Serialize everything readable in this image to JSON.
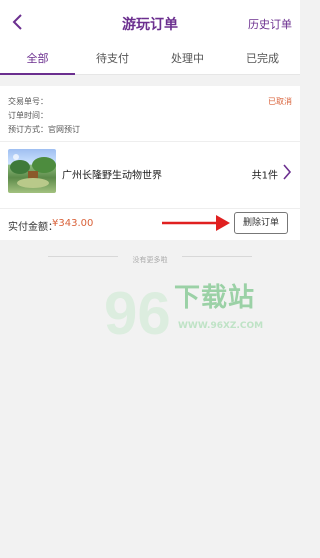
{
  "header": {
    "title": "游玩订单",
    "history_label": "历史订单"
  },
  "tabs": [
    {
      "label": "全部",
      "active": true
    },
    {
      "label": "待支付",
      "active": false
    },
    {
      "label": "处理中",
      "active": false
    },
    {
      "label": "已完成",
      "active": false
    }
  ],
  "order": {
    "order_no_label": "交易单号：",
    "order_time_label": "订单时间：",
    "booking_method": "预订方式：官网预订",
    "status": "已取消",
    "product_name": "广州长隆野生动物世界",
    "quantity": "共1件",
    "amount_label": "实付金额：",
    "amount_value": "¥343.00",
    "delete_label": "删除订单"
  },
  "footer": {
    "no_more_text": "没有更多啦"
  },
  "watermark": {
    "text": "下载站",
    "sub": "WWW.96XZ.COM",
    "number": "96"
  },
  "colors": {
    "accent": "#6b2f8f",
    "price": "#d9623a",
    "arrow": "#e02020"
  }
}
